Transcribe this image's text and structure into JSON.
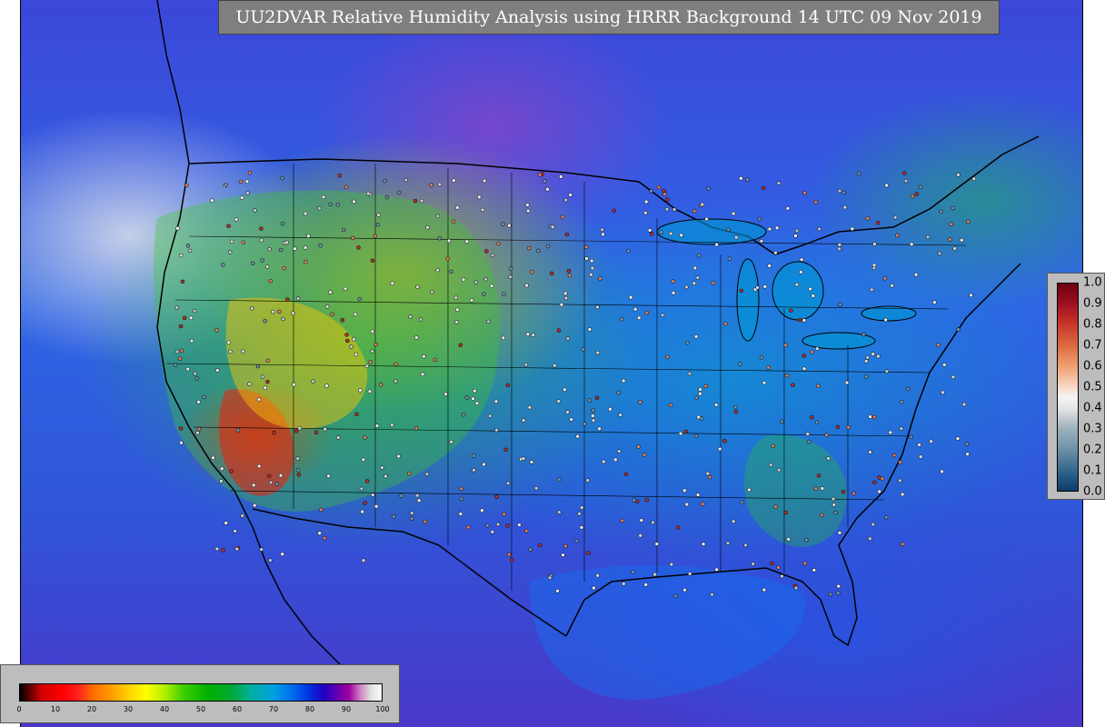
{
  "title": "UU2DVAR Relative Humidity Analysis using HRRR Background 14 UTC 09 Nov 2019",
  "rh_colorbar": {
    "ticks": [
      "0",
      "10",
      "20",
      "30",
      "40",
      "50",
      "60",
      "70",
      "80",
      "90",
      "100"
    ]
  },
  "increment_colorbar": {
    "ticks": [
      "1.0",
      "0.9",
      "0.8",
      "0.7",
      "0.6",
      "0.5",
      "0.4",
      "0.3",
      "0.2",
      "0.1",
      "0.0"
    ]
  },
  "colors": {
    "title_background": "#7f7f7f",
    "legend_background": "#bdbdbd",
    "boundary_line": "#000000",
    "station_dot_fill": "#d9d9d9"
  }
}
